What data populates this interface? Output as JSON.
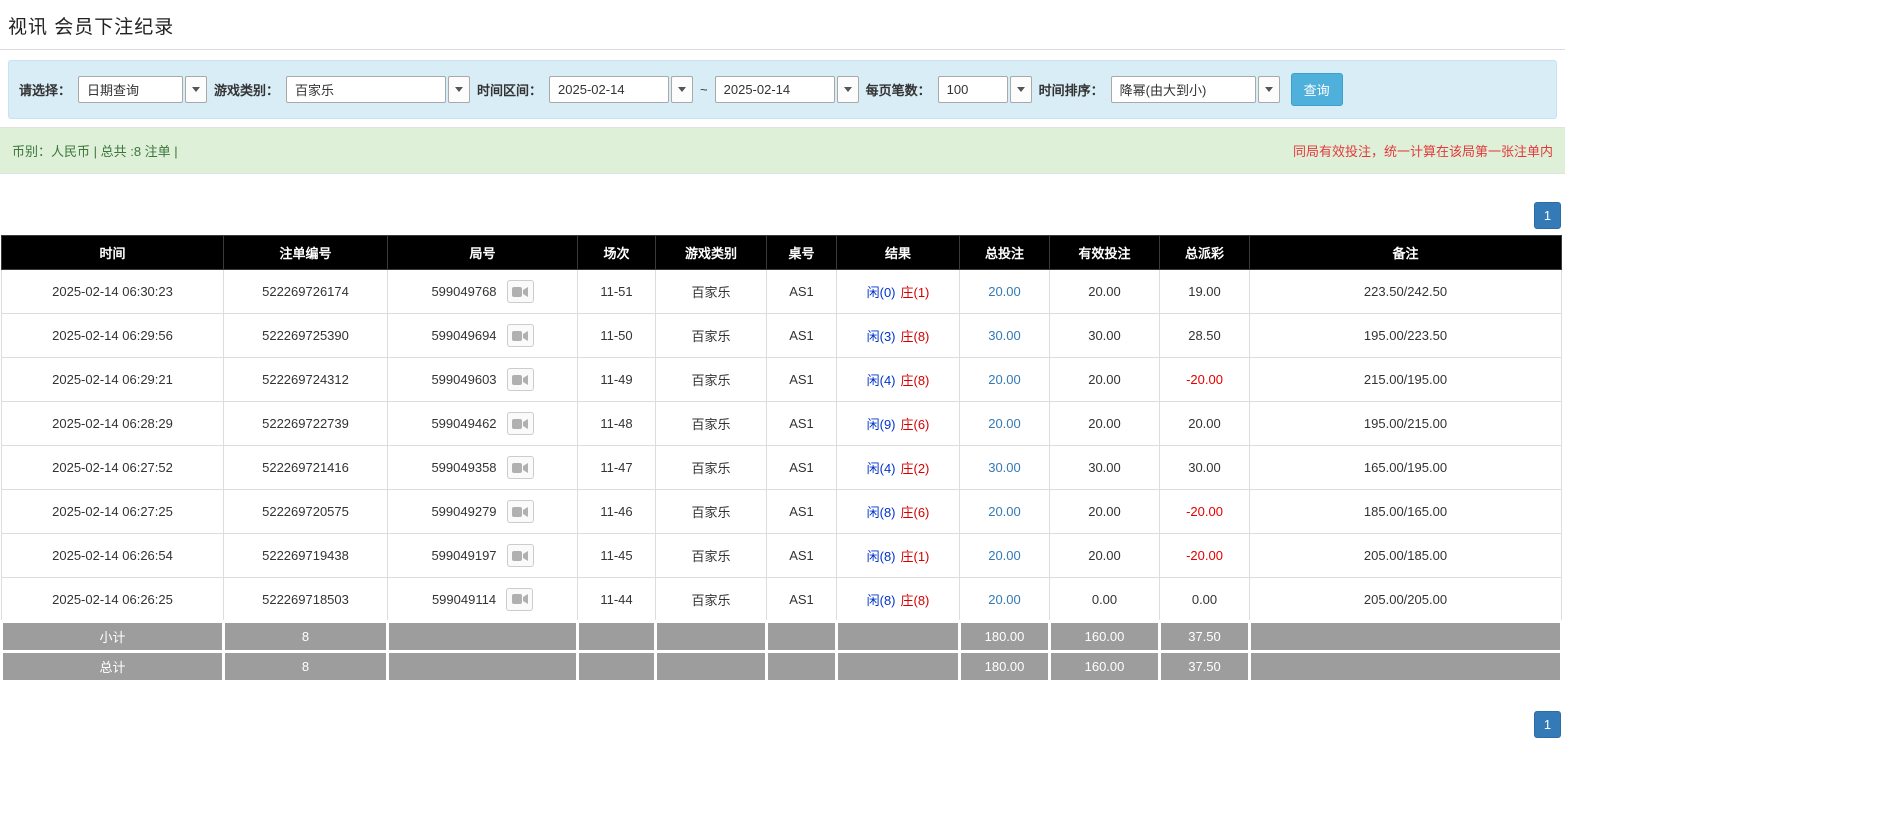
{
  "page": {
    "title": "视讯 会员下注纪录"
  },
  "colors": {
    "filter_bar_bg": "#d9edf7",
    "summary_bar_bg": "#dff0d8",
    "table_header_bg": "#000000",
    "footer_row_bg": "#9d9d9d",
    "player_blue": "#0033cc",
    "banker_red": "#d50000",
    "negative_red": "#e60000",
    "link_blue": "#337ab7",
    "pagination_blue": "#337ab7",
    "query_button_blue": "#4fb0dc",
    "notice_red": "#e4393c"
  },
  "filters": {
    "select_label": "请选择：",
    "select_value": "日期查询",
    "game_label": "游戏类别：",
    "game_value": "百家乐",
    "range_label": "时间区间：",
    "range_start": "2025-02-14",
    "range_sep": "~",
    "range_end": "2025-02-14",
    "per_page_label": "每页笔数：",
    "per_page_value": "100",
    "sort_label": "时间排序：",
    "sort_value": "降幂(由大到小)",
    "query_button": "查询"
  },
  "summary": {
    "left": "币别：人民币 | 总共 :8 注单 |",
    "right": "同局有效投注，统一计算在该局第一张注单内"
  },
  "pagination": {
    "page": "1"
  },
  "table": {
    "headers": [
      "时间",
      "注单编号",
      "局号",
      "场次",
      "游戏类别",
      "桌号",
      "结果",
      "总投注",
      "有效投注",
      "总派彩",
      "备注"
    ],
    "rows": [
      {
        "time": "2025-02-14 06:30:23",
        "bet_id": "522269726174",
        "round": "599049768",
        "session": "11-51",
        "game": "百家乐",
        "table_no": "AS1",
        "result_player": "闲(0)",
        "result_banker": "庄(1)",
        "total_bet": "20.00",
        "valid_bet": "20.00",
        "payout": "19.00",
        "remark": "223.50/242.50"
      },
      {
        "time": "2025-02-14 06:29:56",
        "bet_id": "522269725390",
        "round": "599049694",
        "session": "11-50",
        "game": "百家乐",
        "table_no": "AS1",
        "result_player": "闲(3)",
        "result_banker": "庄(8)",
        "total_bet": "30.00",
        "valid_bet": "30.00",
        "payout": "28.50",
        "remark": "195.00/223.50"
      },
      {
        "time": "2025-02-14 06:29:21",
        "bet_id": "522269724312",
        "round": "599049603",
        "session": "11-49",
        "game": "百家乐",
        "table_no": "AS1",
        "result_player": "闲(4)",
        "result_banker": "庄(8)",
        "total_bet": "20.00",
        "valid_bet": "20.00",
        "payout": "-20.00",
        "remark": "215.00/195.00"
      },
      {
        "time": "2025-02-14 06:28:29",
        "bet_id": "522269722739",
        "round": "599049462",
        "session": "11-48",
        "game": "百家乐",
        "table_no": "AS1",
        "result_player": "闲(9)",
        "result_banker": "庄(6)",
        "total_bet": "20.00",
        "valid_bet": "20.00",
        "payout": "20.00",
        "remark": "195.00/215.00"
      },
      {
        "time": "2025-02-14 06:27:52",
        "bet_id": "522269721416",
        "round": "599049358",
        "session": "11-47",
        "game": "百家乐",
        "table_no": "AS1",
        "result_player": "闲(4)",
        "result_banker": "庄(2)",
        "total_bet": "30.00",
        "valid_bet": "30.00",
        "payout": "30.00",
        "remark": "165.00/195.00"
      },
      {
        "time": "2025-02-14 06:27:25",
        "bet_id": "522269720575",
        "round": "599049279",
        "session": "11-46",
        "game": "百家乐",
        "table_no": "AS1",
        "result_player": "闲(8)",
        "result_banker": "庄(6)",
        "total_bet": "20.00",
        "valid_bet": "20.00",
        "payout": "-20.00",
        "remark": "185.00/165.00"
      },
      {
        "time": "2025-02-14 06:26:54",
        "bet_id": "522269719438",
        "round": "599049197",
        "session": "11-45",
        "game": "百家乐",
        "table_no": "AS1",
        "result_player": "闲(8)",
        "result_banker": "庄(1)",
        "total_bet": "20.00",
        "valid_bet": "20.00",
        "payout": "-20.00",
        "remark": "205.00/185.00"
      },
      {
        "time": "2025-02-14 06:26:25",
        "bet_id": "522269718503",
        "round": "599049114",
        "session": "11-44",
        "game": "百家乐",
        "table_no": "AS1",
        "result_player": "闲(8)",
        "result_banker": "庄(8)",
        "total_bet": "20.00",
        "valid_bet": "0.00",
        "payout": "0.00",
        "remark": "205.00/205.00"
      }
    ],
    "subtotal": {
      "label": "小计",
      "count": "8",
      "total_bet": "180.00",
      "valid_bet": "160.00",
      "payout": "37.50"
    },
    "total": {
      "label": "总计",
      "count": "8",
      "total_bet": "180.00",
      "valid_bet": "160.00",
      "payout": "37.50"
    }
  }
}
